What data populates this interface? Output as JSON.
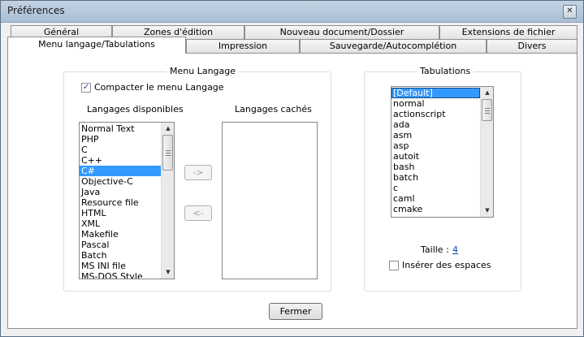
{
  "window": {
    "title": "Préférences",
    "close_symbol": "✕"
  },
  "tabs_back": [
    "Général",
    "Zones d'édition",
    "Nouveau document/Dossier",
    "Extensions de fichier"
  ],
  "tabs_front": [
    "Menu langage/Tabulations",
    "Impression",
    "Sauvegarde/Autocomplétion",
    "Divers"
  ],
  "menu_langage": {
    "title": "Menu Langage",
    "compact_label": "Compacter le menu Langage",
    "compact_checked": true,
    "available_title": "Langages disponibles",
    "hidden_title": "Langages cachés",
    "available_items": [
      "Normal Text",
      "PHP",
      "C",
      "C++",
      "C#",
      "Objective-C",
      "Java",
      "Resource file",
      "HTML",
      "XML",
      "Makefile",
      "Pascal",
      "Batch",
      "MS INI file",
      "MS-DOS Style"
    ],
    "selected_item": "C#",
    "hidden_items": [],
    "move_right_label": "->",
    "move_left_label": "<-"
  },
  "tabulations": {
    "title": "Tabulations",
    "items": [
      "[Default]",
      "normal",
      "actionscript",
      "ada",
      "asm",
      "asp",
      "autoit",
      "bash",
      "batch",
      "c",
      "caml",
      "cmake"
    ],
    "selected_item": "[Default]",
    "size_label": "Taille :",
    "size_value": "4",
    "spaces_label": "Insérer des espaces",
    "spaces_checked": false
  },
  "close_button_label": "Fermer",
  "check_mark": "✓",
  "arrow_up": "▲",
  "arrow_down": "▼"
}
